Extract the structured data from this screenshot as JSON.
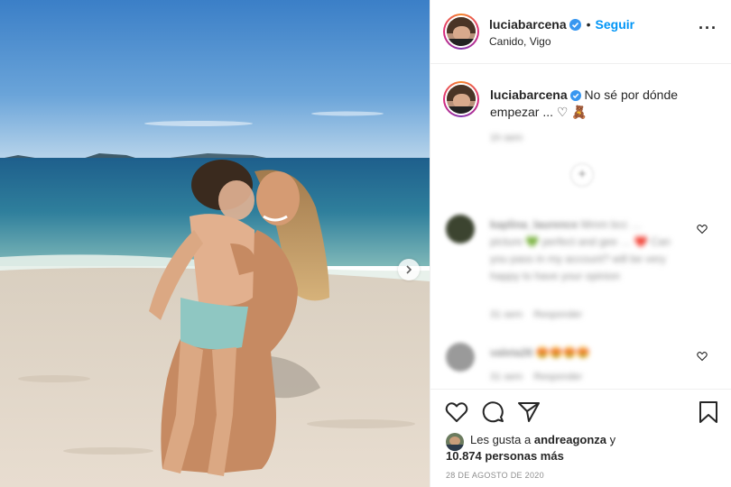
{
  "post": {
    "username": "luciabarcena",
    "follow_label": "Seguir",
    "location": "Canido, Vigo",
    "caption": "No sé por dónde empezar ... ♡ 🧸",
    "caption_time": "1h sem",
    "more_icon": "more-options-icon"
  },
  "comments": [
    {
      "username": "kaplina_laurence",
      "text": "Mmm bcc … picture 💚 perfect and gee … ❤️ Can you pass in my account? will be very happy to have your opinion",
      "time": "31 sem",
      "reply_label": "Responder"
    },
    {
      "username": "valeta26",
      "text": "😍😍😍😍",
      "time": "31 sem",
      "reply_label": "Responder"
    }
  ],
  "likes": {
    "prefix": "Les gusta a",
    "first_user": "andreagonza",
    "connector": "y",
    "others": "10.874 personas más"
  },
  "date": "28 DE AGOSTO DE 2020",
  "colors": {
    "follow_blue": "#0095f6",
    "verified_blue": "#3897f0",
    "text": "#262626",
    "muted": "#8e8e8e",
    "border": "#efefef"
  },
  "icons": [
    "like-icon",
    "comment-icon",
    "share-icon",
    "save-icon",
    "next-photo-icon",
    "load-more-comments-icon"
  ]
}
